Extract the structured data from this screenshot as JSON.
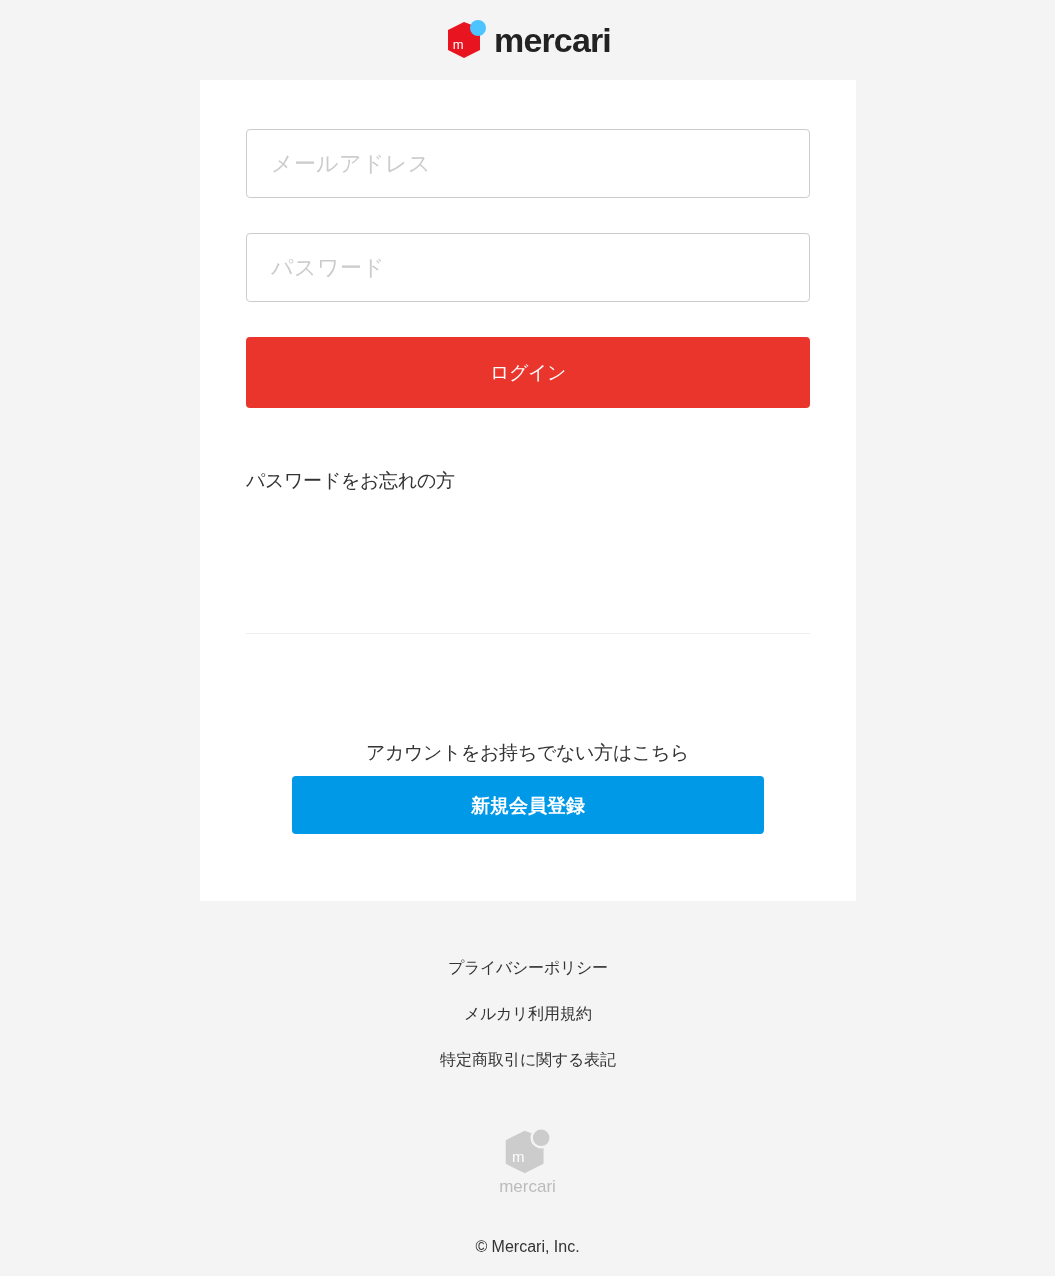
{
  "header": {
    "logo_mark": "m",
    "logo_text": "mercari"
  },
  "form": {
    "email": {
      "placeholder": "メールアドレス"
    },
    "password": {
      "placeholder": "パスワード"
    },
    "login_button": "ログイン",
    "forgot_link": "パスワードをお忘れの方"
  },
  "signup": {
    "prompt": "アカウントをお持ちでない方はこちら",
    "button": "新規会員登録"
  },
  "footer": {
    "links": [
      "プライバシーポリシー",
      "メルカリ利用規約",
      "特定商取引に関する表記"
    ],
    "logo_mark": "m",
    "logo_text": "mercari",
    "copyright": "© Mercari, Inc."
  }
}
